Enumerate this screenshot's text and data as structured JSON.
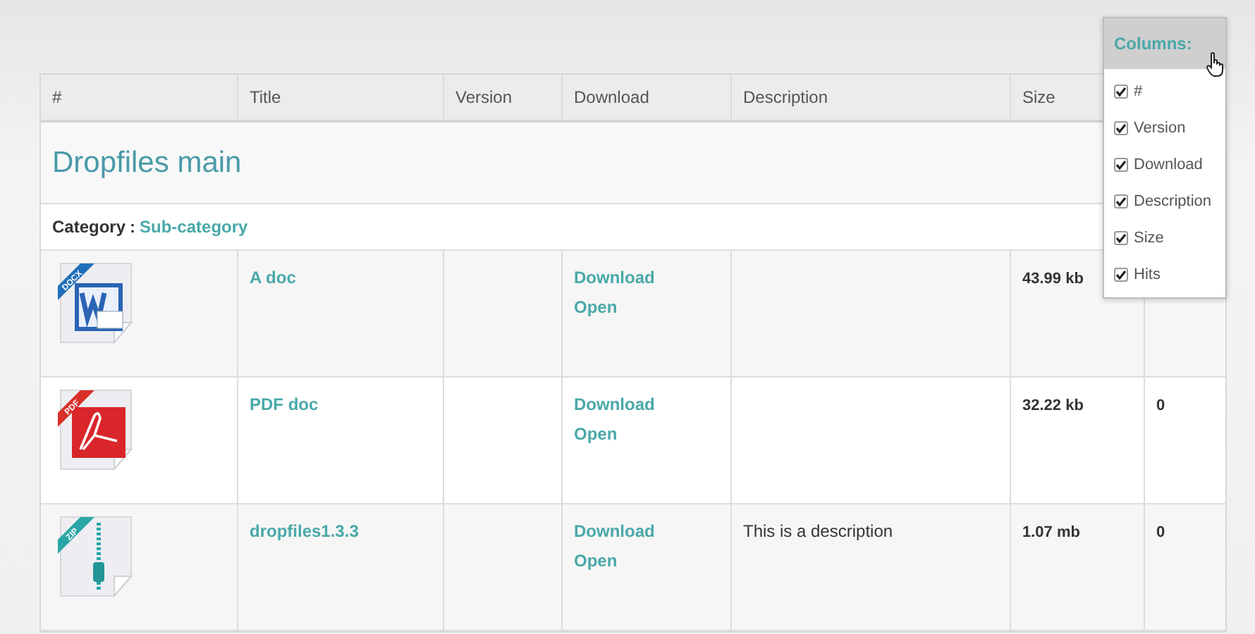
{
  "table": {
    "columns": [
      "#",
      "Title",
      "Version",
      "Download",
      "Description",
      "Size"
    ],
    "section_title": "Dropfiles main",
    "category": {
      "label": "Category",
      "separator": ":",
      "link": "Sub-category"
    },
    "rows": [
      {
        "icon": {
          "kind": "docx",
          "badge": "DOCX"
        },
        "title": "A doc",
        "download": "Download",
        "open": "Open",
        "description": null,
        "size": "43.99 kb",
        "hits": null
      },
      {
        "icon": {
          "kind": "pdf",
          "badge": "PDF"
        },
        "title": "PDF doc",
        "download": "Download",
        "open": "Open",
        "description": null,
        "size": "32.22 kb",
        "hits": "0"
      },
      {
        "icon": {
          "kind": "zip",
          "badge": "ZIP"
        },
        "title": "dropfiles1.3.3",
        "download": "Download",
        "open": "Open",
        "description": "This is a description",
        "size": "1.07 mb",
        "hits": "0"
      }
    ]
  },
  "columns_menu": {
    "title": "Columns:",
    "items": [
      {
        "label": "#",
        "checked": true
      },
      {
        "label": "Version",
        "checked": true
      },
      {
        "label": "Download",
        "checked": true
      },
      {
        "label": "Description",
        "checked": true
      },
      {
        "label": "Size",
        "checked": true
      },
      {
        "label": "Hits",
        "checked": true
      }
    ]
  }
}
